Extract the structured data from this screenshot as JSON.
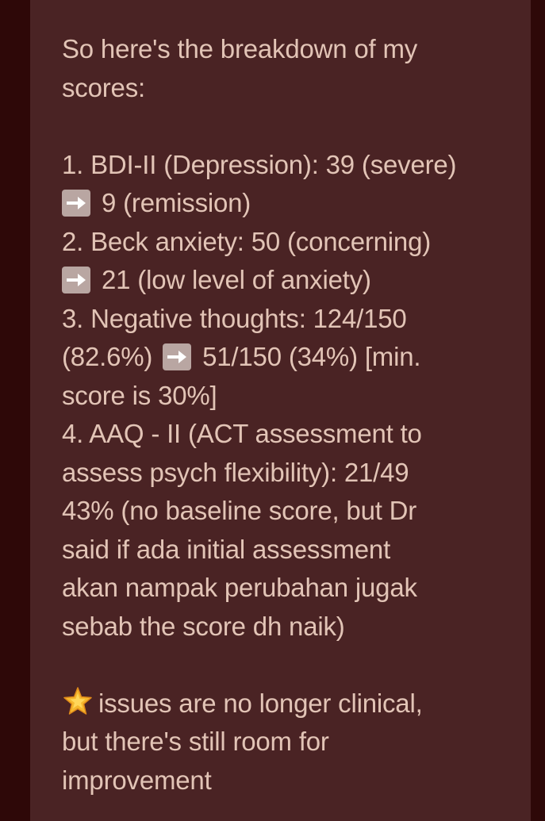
{
  "post": {
    "lines": [
      "So here's the breakdown of my",
      "scores:",
      "",
      "1. BDI-II (Depression): 39 (severe)",
      "9 (remission)",
      "2. Beck anxiety: 50 (concerning)",
      "21 (low level of anxiety)",
      "3. Negative thoughts: 124/150",
      "(82.6%)",
      "51/150 (34%) [min.",
      "score is 30%]",
      "4. AAQ - II (ACT assessment to",
      "assess psych flexibility): 21/49",
      "43% (no baseline score, but Dr",
      "said if ada initial assessment",
      "akan nampak perubahan jugak",
      "sebab the score dh naik)",
      "",
      "issues are no longer clinical,",
      "but there's still room for",
      "improvement"
    ]
  },
  "icons": {
    "arrow": "right-arrow-icon",
    "star": "glowing-star-icon"
  },
  "colors": {
    "background": "#2e0808",
    "card": "#4a2324",
    "text": "#e2c4b6"
  }
}
